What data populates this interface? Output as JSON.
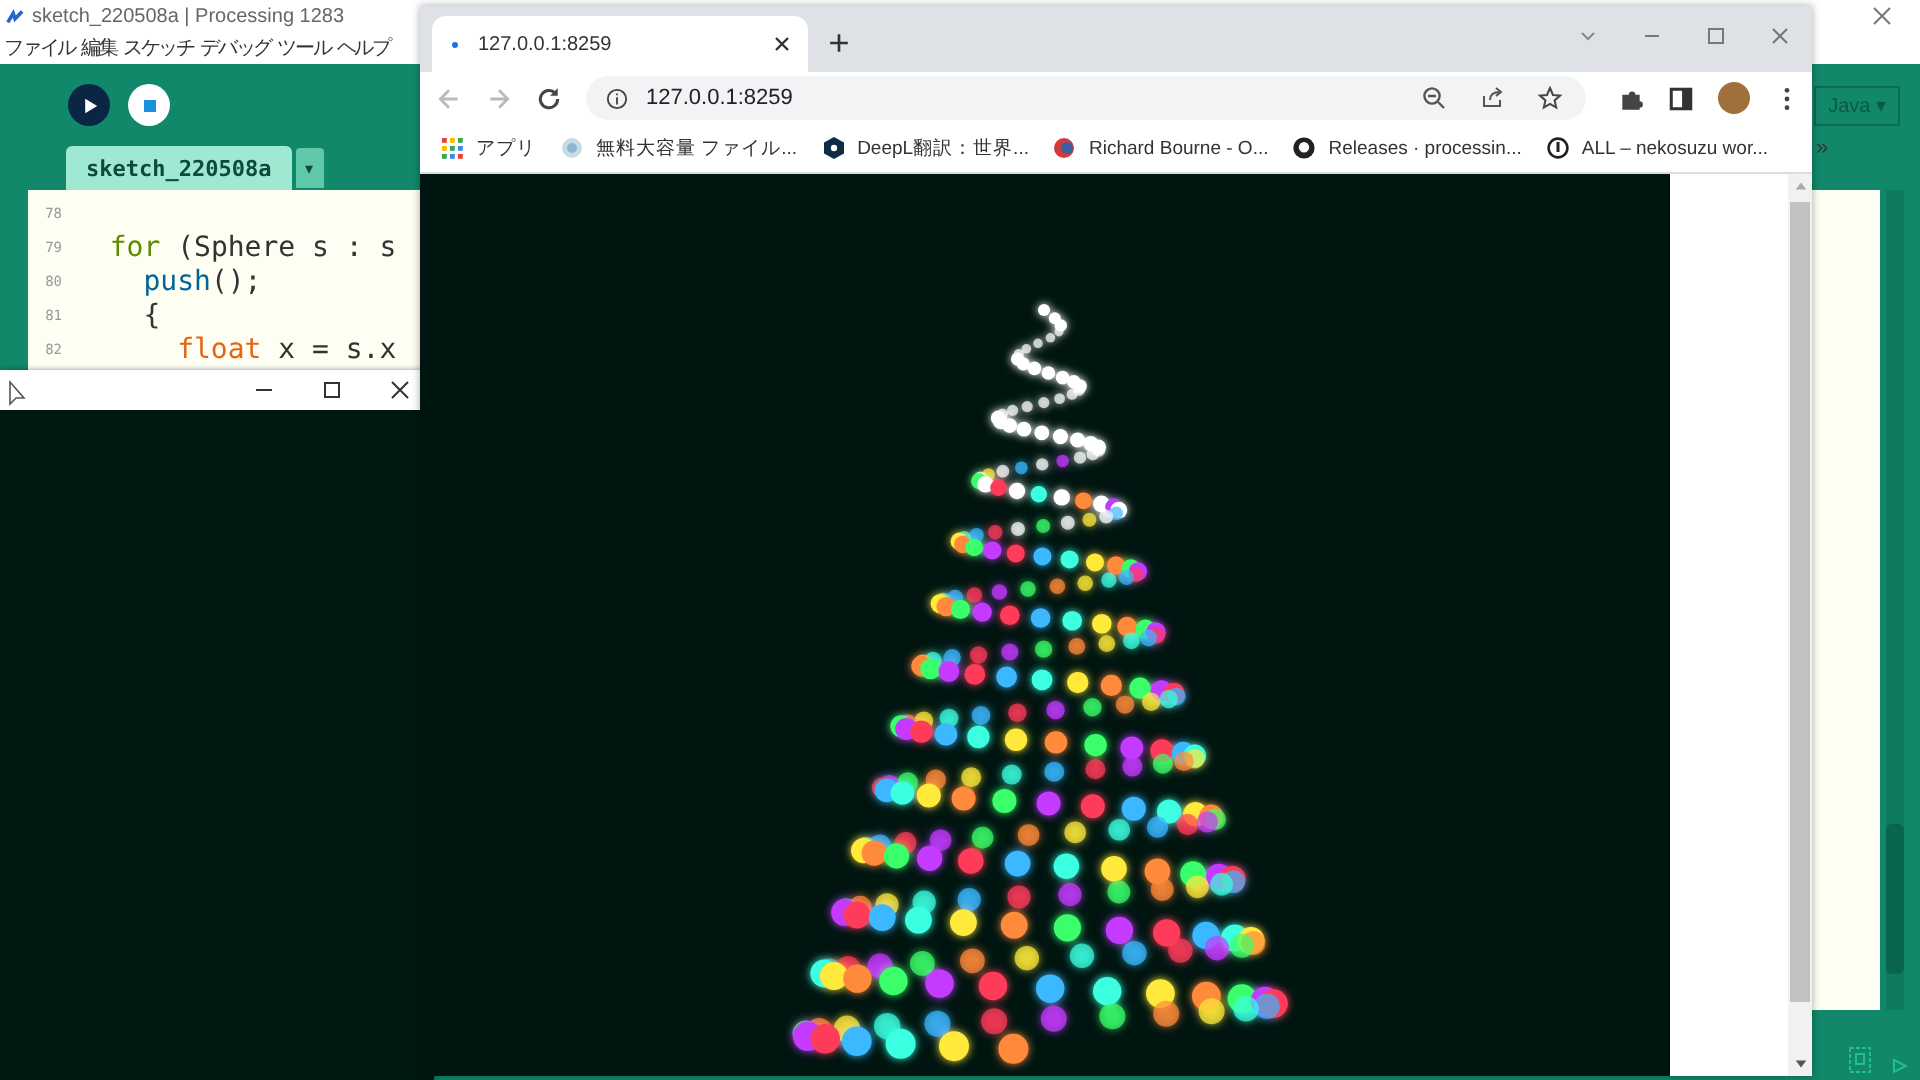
{
  "ide": {
    "title": "sketch_220508a | Processing 1283",
    "menu": [
      "ファイル",
      "編集",
      "スケッチ",
      "デバッグ",
      "ツール",
      "ヘルプ"
    ],
    "tab": "sketch_220508a",
    "mode": "Java ▾",
    "tab_menu": "▾",
    "code": [
      {
        "number": "78"
      },
      {
        "number": "79",
        "tokens": [
          {
            "text": "  for",
            "kind": "keyword"
          },
          {
            "text": " (Sphere s : s",
            "kind": "plain"
          }
        ]
      },
      {
        "number": "80",
        "tokens": [
          {
            "text": "    push",
            "kind": "function"
          },
          {
            "text": "();",
            "kind": "plain"
          }
        ]
      },
      {
        "number": "81",
        "tokens": [
          {
            "text": "    {",
            "kind": "plain"
          }
        ]
      },
      {
        "number": "82",
        "tokens": [
          {
            "text": "      float",
            "kind": "type"
          },
          {
            "text": " x = s.x",
            "kind": "plain"
          }
        ]
      }
    ]
  },
  "browser": {
    "tab_title": "127.0.0.1:8259",
    "url": "127.0.0.1:8259",
    "bookmarks": [
      "アプリ",
      "無料大容量 ファイル...",
      "DeepL翻訳：世界...",
      "Richard Bourne - O...",
      "Releases · processin...",
      "ALL – nekosuzu wor..."
    ],
    "more": "»"
  }
}
